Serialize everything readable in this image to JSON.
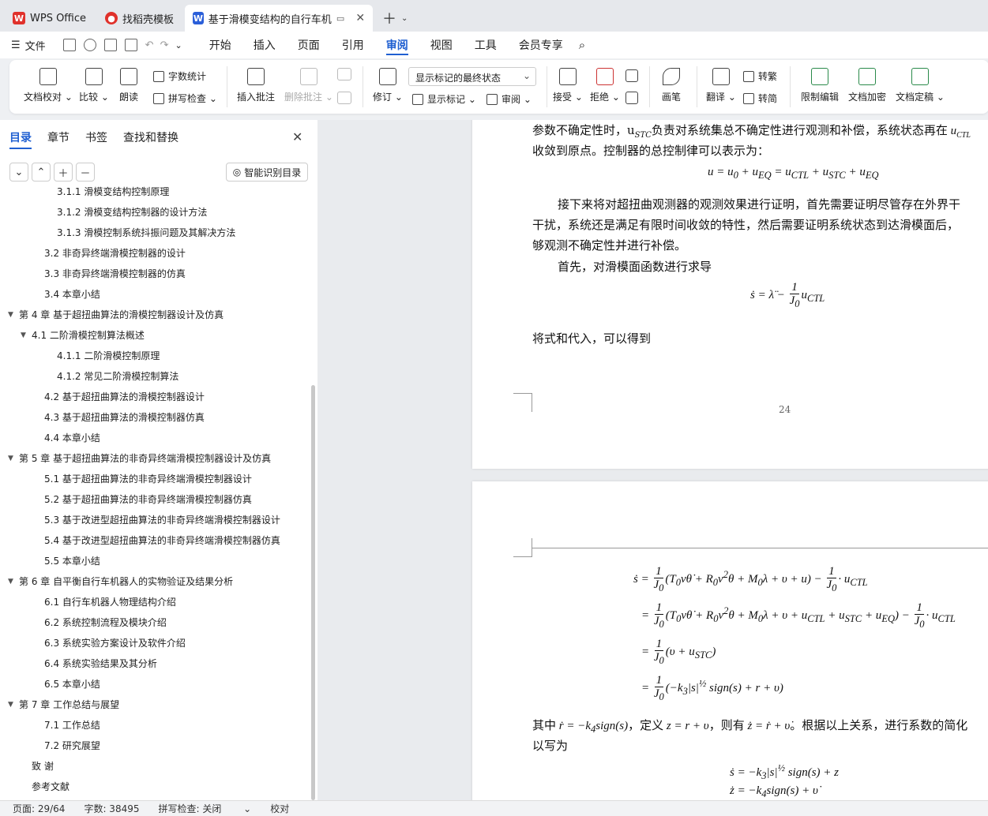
{
  "tabs": [
    {
      "label": "WPS Office",
      "icon": "wps-logo-icon"
    },
    {
      "label": "找稻壳模板",
      "icon": "docer-icon"
    },
    {
      "label": "基于滑模变结构的自行车机器人",
      "icon": "word-doc-icon"
    }
  ],
  "menu": {
    "file": "文件",
    "tabs": [
      "开始",
      "插入",
      "页面",
      "引用",
      "审阅",
      "视图",
      "工具",
      "会员专享"
    ],
    "active_tab": "审阅"
  },
  "ribbon": {
    "doc_check": "文档校对",
    "compare": "比较",
    "read_aloud": "朗读",
    "word_count": "字数统计",
    "spell_check": "拼写检查",
    "insert_comment": "插入批注",
    "delete_comment": "删除批注",
    "track": "修订",
    "markup_select": "显示标记的最终状态",
    "show_markup": "显示标记",
    "review": "审阅",
    "accept": "接受",
    "reject": "拒绝",
    "ink": "画笔",
    "translate": "翻译",
    "to_trad": "转繁",
    "to_simp": "转简",
    "restrict": "限制编辑",
    "encrypt": "文档加密",
    "finalize": "文档定稿"
  },
  "sidebar": {
    "tabs": [
      "目录",
      "章节",
      "书签",
      "查找和替换"
    ],
    "smart_btn": "智能识别目录",
    "toc": [
      {
        "text": "3.1.1 滑模变结构控制原理",
        "level": 3,
        "arrow": ""
      },
      {
        "text": "3.1.2  滑模变结构控制器的设计方法",
        "level": 3,
        "arrow": ""
      },
      {
        "text": "3.1.3  滑模控制系统抖振问题及其解决方法",
        "level": 3,
        "arrow": ""
      },
      {
        "text": "3.2  非奇异终端滑模控制器的设计",
        "level": 2,
        "arrow": ""
      },
      {
        "text": "3.3  非奇异终端滑模控制器的仿真",
        "level": 2,
        "arrow": ""
      },
      {
        "text": "3.4  本章小结",
        "level": 2,
        "arrow": ""
      },
      {
        "text": "第 4 章  基于超扭曲算法的滑模控制器设计及仿真",
        "level": 1,
        "arrow": "▼"
      },
      {
        "text": "4.1  二阶滑模控制算法概述",
        "level": 2,
        "arrow": "▼"
      },
      {
        "text": "4.1.1  二阶滑模控制原理",
        "level": 3,
        "arrow": ""
      },
      {
        "text": "4.1.2  常见二阶滑模控制算法",
        "level": 3,
        "arrow": ""
      },
      {
        "text": "4.2  基于超扭曲算法的滑模控制器设计",
        "level": 2,
        "arrow": ""
      },
      {
        "text": "4.3  基于超扭曲算法的滑模控制器仿真",
        "level": 2,
        "arrow": ""
      },
      {
        "text": "4.4  本章小结",
        "level": 2,
        "arrow": ""
      },
      {
        "text": "第 5 章  基于超扭曲算法的非奇异终端滑模控制器设计及仿真",
        "level": 1,
        "arrow": "▼"
      },
      {
        "text": "5.1  基于超扭曲算法的非奇异终端滑模控制器设计",
        "level": 2,
        "arrow": ""
      },
      {
        "text": "5.2  基于超扭曲算法的非奇异终端滑模控制器仿真",
        "level": 2,
        "arrow": ""
      },
      {
        "text": "5.3  基于改进型超扭曲算法的非奇异终端滑模控制器设计",
        "level": 2,
        "arrow": ""
      },
      {
        "text": "5.4  基于改进型超扭曲算法的非奇异终端滑模控制器仿真",
        "level": 2,
        "arrow": ""
      },
      {
        "text": "5.5  本章小结",
        "level": 2,
        "arrow": ""
      },
      {
        "text": "第 6 章  自平衡自行车机器人的实物验证及结果分析",
        "level": 1,
        "arrow": "▼"
      },
      {
        "text": "6.1  自行车机器人物理结构介绍",
        "level": 2,
        "arrow": ""
      },
      {
        "text": "6.2  系统控制流程及模块介绍",
        "level": 2,
        "arrow": ""
      },
      {
        "text": "6.3  系统实验方案设计及软件介绍",
        "level": 2,
        "arrow": ""
      },
      {
        "text": "6.4  系统实验结果及其分析",
        "level": 2,
        "arrow": ""
      },
      {
        "text": "6.5  本章小结",
        "level": 2,
        "arrow": ""
      },
      {
        "text": "第 7 章  工作总结与展望",
        "level": 1,
        "arrow": "▼"
      },
      {
        "text": "7.1  工作总结",
        "level": 2,
        "arrow": ""
      },
      {
        "text": "7.2  研究展望",
        "level": 2,
        "arrow": ""
      },
      {
        "text": "致    谢",
        "level": 1,
        "arrow": ""
      },
      {
        "text": "参考文献",
        "level": 1,
        "arrow": ""
      }
    ]
  },
  "doc": {
    "p1_line1": "参数不确定性时，u",
    "p1_line1_sub": "STC",
    "p1_line1_rest": "负责对系统集总不确定性进行观测和补偿，系统状态再在",
    "p1_line2": "收敛到原点。控制器的总控制律可以表示为：",
    "p1_eq1": "u = u₀ + u_EQ = u_CTL + u_STC + u_EQ",
    "p1_para2_l1": "接下来将对超扭曲观测器的观测效果进行证明，首先需要证明尽管存在外界干",
    "p1_para2_l2": "干扰，系统还是满足有限时间收敛的特性，然后需要证明系统状态到达滑模面后，",
    "p1_para2_l3": "够观测不确定性并进行补偿。",
    "p1_para3": "首先，对滑模面函数进行求导",
    "p1_para4": "将式和代入，可以得到",
    "page_number": "24",
    "p2_text1": "其中",
    "p2_text1b": "，定义",
    "p2_text1c": "，则有",
    "p2_text1d": "。根据以上关系，进行系数的简化",
    "p2_text2": "以写为"
  },
  "status": {
    "page": "页面: 29/64",
    "words": "字数: 38495",
    "spell": "拼写检查: 关闭",
    "proof": "校对"
  }
}
